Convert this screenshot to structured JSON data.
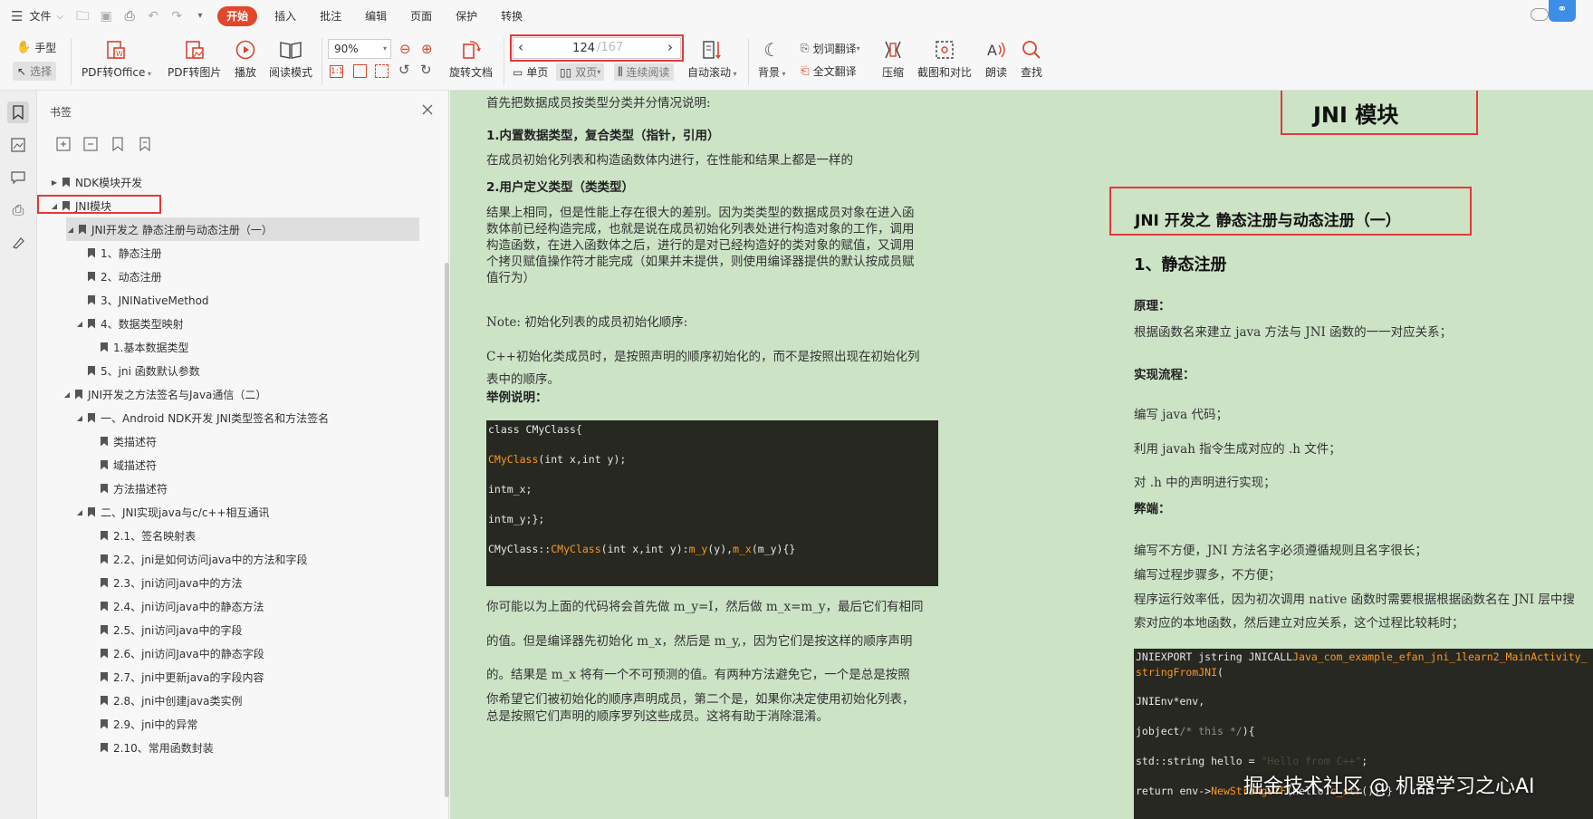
{
  "menu": {
    "file": "文件",
    "tabs": [
      "开始",
      "插入",
      "批注",
      "编辑",
      "页面",
      "保护",
      "转换"
    ],
    "active": "开始"
  },
  "toolbar": {
    "hand": "手型",
    "select": "选择",
    "pdf_to_office": "PDF转Office",
    "pdf_to_image": "PDF转图片",
    "play": "播放",
    "read_mode": "阅读模式",
    "zoom_value": "90%",
    "rotate": "旋转文档",
    "page_current": "124",
    "page_total": "/167",
    "single_page": "单页",
    "double_page": "双页",
    "continuous": "连续阅读",
    "auto_scroll": "自动滚动",
    "background": "背景",
    "word_translate": "划词翻译",
    "full_translate": "全文翻译",
    "compress": "压缩",
    "screenshot_compare": "截图和对比",
    "read_aloud": "朗读",
    "find": "查找"
  },
  "bookmarks": {
    "title": "书签",
    "items": [
      {
        "label": "NDK模块开发",
        "level": 0,
        "toggle": "right"
      },
      {
        "label": "JNI模块",
        "level": 0,
        "toggle": "down"
      },
      {
        "label": "JNI开发之 静态注册与动态注册（一）",
        "level": 1,
        "toggle": "down"
      },
      {
        "label": "1、静态注册",
        "level": 2,
        "toggle": ""
      },
      {
        "label": "2、动态注册",
        "level": 2,
        "toggle": ""
      },
      {
        "label": "3、JNINativeMethod",
        "level": 2,
        "toggle": ""
      },
      {
        "label": "4、数据类型映射",
        "level": 2,
        "toggle": "down"
      },
      {
        "label": "1.基本数据类型",
        "level": 3,
        "toggle": ""
      },
      {
        "label": "5、jni 函数默认参数",
        "level": 2,
        "toggle": ""
      },
      {
        "label": "JNI开发之方法签名与Java通信（二）",
        "level": 1,
        "toggle": "down"
      },
      {
        "label": "一、Android NDK开发 JNI类型签名和方法签名",
        "level": 2,
        "toggle": "down"
      },
      {
        "label": "类描述符",
        "level": 3,
        "toggle": ""
      },
      {
        "label": "域描述符",
        "level": 3,
        "toggle": ""
      },
      {
        "label": "方法描述符",
        "level": 3,
        "toggle": ""
      },
      {
        "label": "二、JNI实现java与c/c++相互通讯",
        "level": 2,
        "toggle": "down"
      },
      {
        "label": "2.1、签名映射表",
        "level": 3,
        "toggle": ""
      },
      {
        "label": "2.2、jni是如何访问java中的方法和字段",
        "level": 3,
        "toggle": ""
      },
      {
        "label": "2.3、jni访问java中的方法",
        "level": 3,
        "toggle": ""
      },
      {
        "label": "2.4、jni访问java中的静态方法",
        "level": 3,
        "toggle": ""
      },
      {
        "label": "2.5、jni访问java中的字段",
        "level": 3,
        "toggle": ""
      },
      {
        "label": "2.6、jni访问Java中的静态字段",
        "level": 3,
        "toggle": ""
      },
      {
        "label": "2.7、jni中更新java的字段内容",
        "level": 3,
        "toggle": ""
      },
      {
        "label": "2.8、jni中创建java类实例",
        "level": 3,
        "toggle": ""
      },
      {
        "label": "2.9、jni中的异常",
        "level": 3,
        "toggle": ""
      },
      {
        "label": "2.10、常用函数封装",
        "level": 3,
        "toggle": ""
      }
    ]
  },
  "left_page": {
    "intro": "首先把数据成员按类型分类并分情况说明:",
    "h1": "1.内置数据类型，复合类型（指针，引用）",
    "p1": "在成员初始化列表和构造函数体内进行，在性能和结果上都是一样的",
    "h2": "2.用户定义类型（类类型）",
    "p2": [
      "结果上相同，但是性能上存在很大的差别。因为类类型的数据成员对象在进入函",
      "数体前已经构造完成，也就是说在成员初始化列表处进行构造对象的工作，调用",
      "构造函数，在进入函数体之后，进行的是对已经构造好的类对象的赋值，又调用",
      "个拷贝赋值操作符才能完成（如果并未提供，则使用编译器提供的默认按成员赋",
      "值行为）"
    ],
    "note": "Note: 初始化列表的成员初始化顺序:",
    "p3": [
      "C++初始化类成员时，是按照声明的顺序初始化的，而不是按照出现在初始化列",
      "表中的顺序。"
    ],
    "example": "举例说明：",
    "code": [
      [
        {
          "t": "class CMyClass{",
          "c": ""
        }
      ],
      [
        {
          "t": "CMyClass",
          "c": "kw"
        },
        {
          "t": "(int x,int y);",
          "c": ""
        }
      ],
      [
        {
          "t": "intm_x;",
          "c": ""
        }
      ],
      [
        {
          "t": "intm_y;};",
          "c": ""
        }
      ],
      [
        {
          "t": "CMyClass::",
          "c": ""
        },
        {
          "t": "CMyClass",
          "c": "kw"
        },
        {
          "t": "(int x,int y):",
          "c": ""
        },
        {
          "t": "m_y",
          "c": "kw"
        },
        {
          "t": "(y),",
          "c": ""
        },
        {
          "t": "m_x",
          "c": "kw"
        },
        {
          "t": "(m_y){}",
          "c": ""
        }
      ]
    ],
    "p4": [
      "你可能以为上面的代码将会首先做 m_y=I，然后做 m_x=m_y，最后它们有相同",
      "的值。但是编译器先初始化 m_x，然后是 m_y,，因为它们是按这样的顺序声明",
      "的。结果是 m_x 将有一个不可预测的值。有两种方法避免它，一个是总是按照",
      "你希望它们被初始化的顺序声明成员，第二个是，如果你决定使用初始化列表，",
      "总是按照它们声明的顺序罗列这些成员。这将有助于消除混淆。"
    ]
  },
  "right_page": {
    "title": "JNI 模块",
    "subtitle": "JNI 开发之 静态注册与动态注册（一）",
    "section": "1、静态注册",
    "principle_label": "原理：",
    "principle": "根据函数名来建立 java 方法与 JNI 函数的一一对应关系；",
    "flow_label": "实现流程：",
    "flow": [
      "编写 java 代码；",
      "利用 javah 指令生成对应的 .h 文件；",
      "对 .h 中的声明进行实现；"
    ],
    "cons_label": "弊端：",
    "cons": [
      "编写不方便，JNI 方法名字必须遵循规则且名字很长；",
      "编写过程步骤多，不方便；",
      "程序运行效率低，因为初次调用 native 函数时需要根据根据函数名在 JNI 层中搜",
      "索对应的本地函数，然后建立对应关系，这个过程比较耗时；"
    ],
    "code": [
      [
        {
          "t": "JNIEXPORT jstring JNICALL",
          "c": ""
        },
        {
          "t": "Java_com_example_efan_jni_1learn2_MainActivity_",
          "c": "kw"
        }
      ],
      [
        {
          "t": "stringFromJNI",
          "c": "kw"
        },
        {
          "t": "(",
          "c": ""
        }
      ],
      [
        {
          "t": "JNIEnv*env,",
          "c": ""
        }
      ],
      [
        {
          "t": "jobject",
          "c": ""
        },
        {
          "t": "/* this */",
          "c": "cm"
        },
        {
          "t": "){",
          "c": ""
        }
      ],
      [
        {
          "t": "std::string hello = ",
          "c": ""
        },
        {
          "t": "\"Hello from C++\"",
          "c": "str"
        },
        {
          "t": ";",
          "c": ""
        }
      ],
      [
        {
          "t": "return env->",
          "c": ""
        },
        {
          "t": "NewStringUTF",
          "c": "kw"
        },
        {
          "t": "(hello.",
          "c": ""
        },
        {
          "t": "c_str",
          "c": "kw"
        },
        {
          "t": "());}",
          "c": ""
        }
      ]
    ]
  },
  "watermark": "掘金技术社区 @ 机器学习之心AI",
  "colors": {
    "accent": "#e2472a",
    "doc_bg": "#cce3c6",
    "highlight_box": "#e3393c",
    "code_bg": "#272822",
    "code_kw": "#fd971f"
  }
}
